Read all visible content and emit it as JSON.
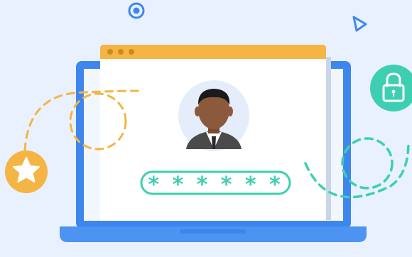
{
  "illustration": {
    "password_field": {
      "masked_value": "* * * * * *"
    },
    "colors": {
      "background": "#e8f1fd",
      "laptop_frame": "#3d86ee",
      "laptop_base": "#4d93f2",
      "window_bar": "#f4b544",
      "window_body": "#ffffff",
      "accent_teal": "#3ecfb2",
      "accent_orange": "#f4b544",
      "avatar_ring": "#e5edfa",
      "skin": "#8b5a3c",
      "hair": "#1a1a1a",
      "suit": "#4a4a4a"
    },
    "icons": [
      "star-icon",
      "lock-icon",
      "play-icon",
      "target-icon",
      "user-avatar"
    ]
  }
}
